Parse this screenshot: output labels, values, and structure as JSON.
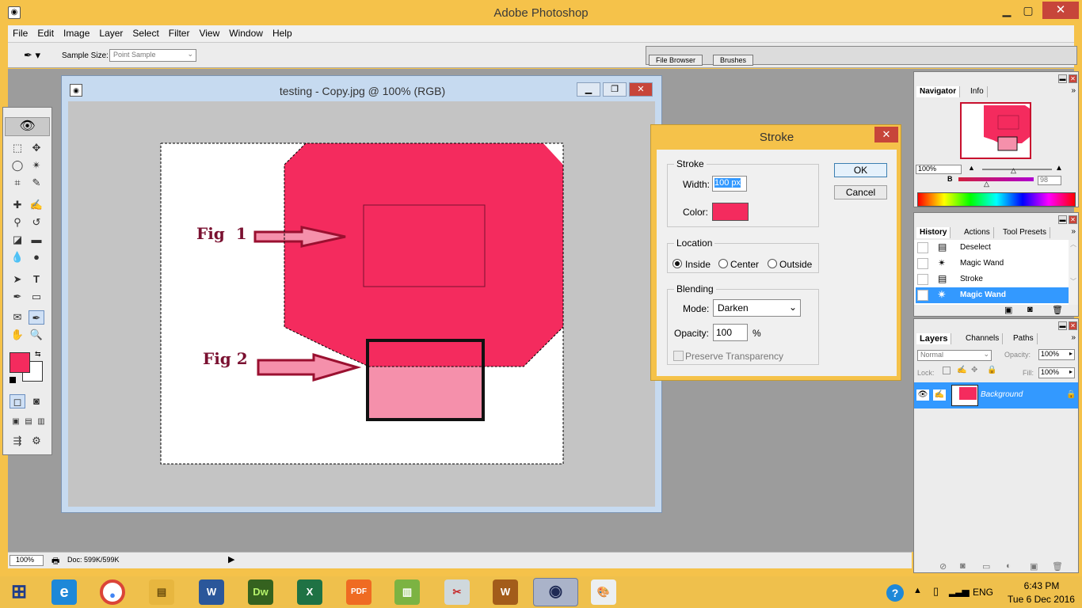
{
  "app": {
    "title": "Adobe Photoshop"
  },
  "menu": [
    "File",
    "Edit",
    "Image",
    "Layer",
    "Select",
    "Filter",
    "View",
    "Window",
    "Help"
  ],
  "options": {
    "sample_size_label": "Sample Size:",
    "sample_size_value": "Point Sample",
    "tabs": [
      "File Browser",
      "Brushes"
    ]
  },
  "document": {
    "title": "testing - Copy.jpg @ 100% (RGB)",
    "fig1_label": "Fig  1",
    "fig2_label": "Fig 2"
  },
  "status": {
    "zoom": "100%",
    "doc_size": "Doc: 599K/599K"
  },
  "stroke_dialog": {
    "title": "Stroke",
    "stroke_group": "Stroke",
    "width_label": "Width:",
    "width_value": "100 px",
    "color_label": "Color:",
    "color_value": "#f42b5e",
    "location_group": "Location",
    "location_options": [
      "Inside",
      "Center",
      "Outside"
    ],
    "location_selected": "Inside",
    "blending_group": "Blending",
    "mode_label": "Mode:",
    "mode_value": "Darken",
    "opacity_label": "Opacity:",
    "opacity_value": "100",
    "opacity_unit": "%",
    "preserve_label": "Preserve Transparency",
    "ok_label": "OK",
    "cancel_label": "Cancel"
  },
  "navigator": {
    "tabs": [
      "Navigator",
      "Info"
    ],
    "zoom": "100%",
    "color_channel": "B",
    "color_value": "98"
  },
  "history": {
    "tabs": [
      "History",
      "Actions",
      "Tool Presets"
    ],
    "items": [
      {
        "label": "Deselect",
        "icon": "deselect-icon"
      },
      {
        "label": "Magic Wand",
        "icon": "magic-wand-icon"
      },
      {
        "label": "Stroke",
        "icon": "stroke-icon"
      },
      {
        "label": "Magic Wand",
        "icon": "magic-wand-icon",
        "active": true
      }
    ]
  },
  "layers": {
    "tabs": [
      "Layers",
      "Channels",
      "Paths"
    ],
    "blend_mode": "Normal",
    "opacity_label": "Opacity:",
    "opacity_value": "100%",
    "lock_label": "Lock:",
    "fill_label": "Fill:",
    "fill_value": "100%",
    "layer_name": "Background"
  },
  "taskbar": {
    "language": "ENG",
    "time": "6:43 PM",
    "date": "Tue 6 Dec 2016"
  },
  "colors": {
    "foreground": "#f42b5e",
    "background": "#ffffff",
    "accent_pink": "#f42b5e",
    "light_pink": "#f590ab",
    "title_bar": "#f5c24a",
    "selection_blue": "#3399ff"
  }
}
